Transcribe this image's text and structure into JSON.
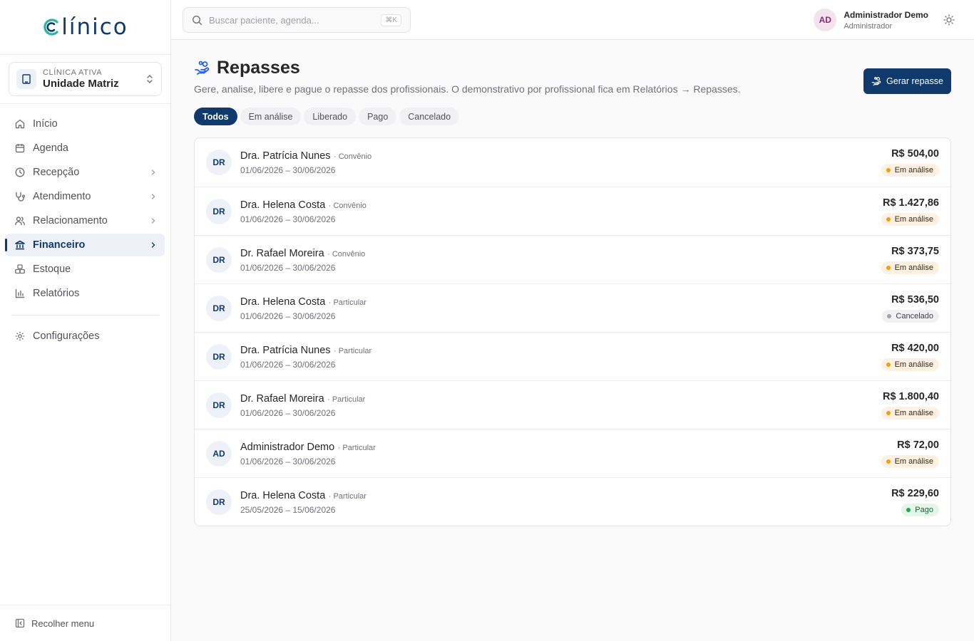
{
  "brand": {
    "logo_text": "línico",
    "logo_initial": "C"
  },
  "clinic": {
    "label": "CLÍNICA ATIVA",
    "name": "Unidade Matriz"
  },
  "nav": {
    "items": [
      {
        "label": "Início",
        "icon": "home-icon"
      },
      {
        "label": "Agenda",
        "icon": "calendar-icon"
      },
      {
        "label": "Recepção",
        "icon": "clock-icon",
        "has_submenu": true
      },
      {
        "label": "Atendimento",
        "icon": "stethoscope-icon",
        "has_submenu": true
      },
      {
        "label": "Relacionamento",
        "icon": "users-icon",
        "has_submenu": true
      },
      {
        "label": "Financeiro",
        "icon": "bank-icon",
        "has_submenu": true,
        "active": true
      },
      {
        "label": "Estoque",
        "icon": "boxes-icon"
      },
      {
        "label": "Relatórios",
        "icon": "bar-chart-icon"
      }
    ],
    "settings_label": "Configurações",
    "collapse_label": "Recolher menu"
  },
  "topbar": {
    "search_placeholder": "Buscar paciente, agenda...",
    "search_shortcut": "⌘K",
    "user_initials": "AD",
    "user_name": "Administrador Demo",
    "user_role": "Administrador"
  },
  "page": {
    "title": "Repasses",
    "subtitle": "Gere, analise, libere e pague o repasse dos profissionais. O demonstrativo por profissional fica em Relatórios → Repasses.",
    "generate_button": "Gerar repasse"
  },
  "tabs": [
    {
      "label": "Todos",
      "active": true
    },
    {
      "label": "Em análise"
    },
    {
      "label": "Liberado"
    },
    {
      "label": "Pago"
    },
    {
      "label": "Cancelado"
    }
  ],
  "rows": [
    {
      "initials": "DR",
      "name": "Dra. Patrícia Nunes",
      "type": "· Convênio",
      "period": "01/06/2026 – 30/06/2026",
      "amount": "R$ 504,00",
      "status": "Em análise",
      "status_key": "analise"
    },
    {
      "initials": "DR",
      "name": "Dra. Helena Costa",
      "type": "· Convênio",
      "period": "01/06/2026 – 30/06/2026",
      "amount": "R$ 1.427,86",
      "status": "Em análise",
      "status_key": "analise"
    },
    {
      "initials": "DR",
      "name": "Dr. Rafael Moreira",
      "type": "· Convênio",
      "period": "01/06/2026 – 30/06/2026",
      "amount": "R$ 373,75",
      "status": "Em análise",
      "status_key": "analise"
    },
    {
      "initials": "DR",
      "name": "Dra. Helena Costa",
      "type": "· Particular",
      "period": "01/06/2026 – 30/06/2026",
      "amount": "R$ 536,50",
      "status": "Cancelado",
      "status_key": "cancelado"
    },
    {
      "initials": "DR",
      "name": "Dra. Patrícia Nunes",
      "type": "· Particular",
      "period": "01/06/2026 – 30/06/2026",
      "amount": "R$ 420,00",
      "status": "Em análise",
      "status_key": "analise"
    },
    {
      "initials": "DR",
      "name": "Dr. Rafael Moreira",
      "type": "· Particular",
      "period": "01/06/2026 – 30/06/2026",
      "amount": "R$ 1.800,40",
      "status": "Em análise",
      "status_key": "analise"
    },
    {
      "initials": "AD",
      "name": "Administrador Demo",
      "type": "· Particular",
      "period": "01/06/2026 – 30/06/2026",
      "amount": "R$ 72,00",
      "status": "Em análise",
      "status_key": "analise"
    },
    {
      "initials": "DR",
      "name": "Dra. Helena Costa",
      "type": "· Particular",
      "period": "25/05/2026 – 15/06/2026",
      "amount": "R$ 229,60",
      "status": "Pago",
      "status_key": "pago"
    }
  ],
  "colors": {
    "primary": "#0f3a6b",
    "warning": "#f59e0b",
    "success": "#22a559",
    "muted": "#a1a1aa"
  }
}
